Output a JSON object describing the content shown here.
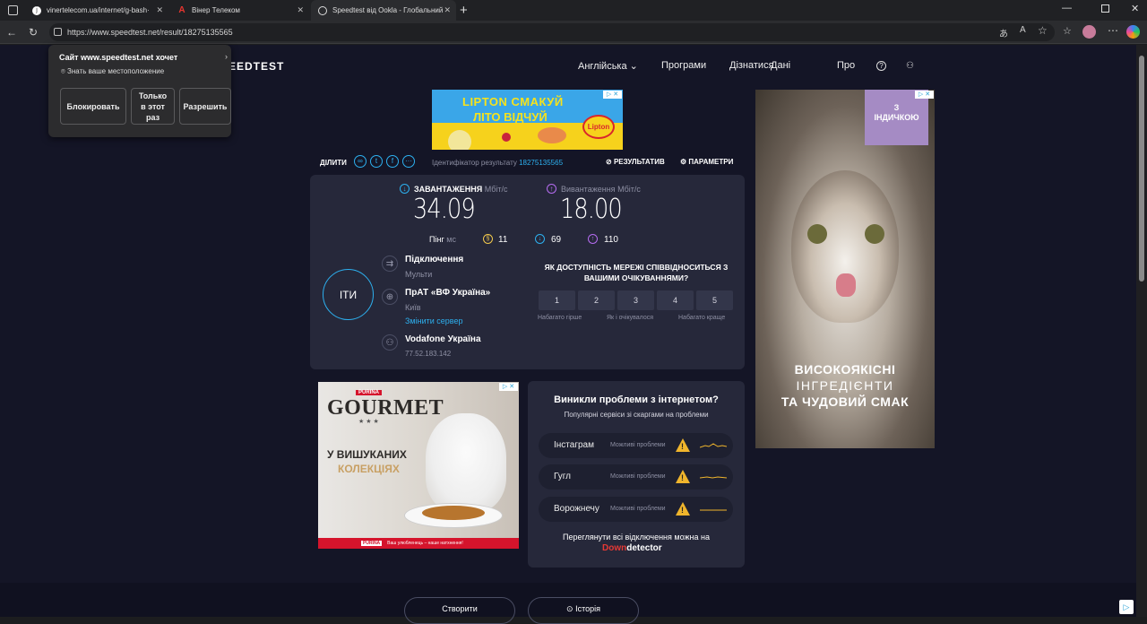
{
  "browser": {
    "tabs": [
      {
        "title": "vinertelecom.ua/internet/g-bash·",
        "favicon": "vt"
      },
      {
        "title": "Вінер Телеком",
        "favicon": "A"
      },
      {
        "title": "Speedtest від Ookla - Глобальний",
        "favicon": "ookla"
      }
    ],
    "url": "https://www.speedtest.net/result/18275135565"
  },
  "permission_popup": {
    "title": "Сайт www.speedtest.net хочет",
    "request": "Знать ваше местоположение",
    "block": "Блокировать",
    "once": "Только в этот раз",
    "allow": "Разрешить"
  },
  "site": {
    "logo": "EEDTEST",
    "nav": [
      "Англійська",
      "Програми",
      "Дізнатися",
      "Дані",
      "Про"
    ]
  },
  "ads": {
    "top_banner": {
      "line1": "LIPTON СМАКУЙ",
      "line2": "ЛІТО ВІДЧУЙ",
      "brand": "Lipton"
    },
    "right": {
      "tag1": "З",
      "tag2": "ІНДИЧКОЮ",
      "line1": "ВИСОКОЯКІСНІ",
      "line2": "ІНГРЕДІЄНТИ",
      "line3": "ТА ЧУДОВИЙ СМАК"
    },
    "bottom": {
      "brand_small": "PURINA",
      "brand": "GOURMET",
      "line1": "У ВИШУКАНИХ",
      "line2": "КОЛЕКЦІЯХ",
      "footer_brand": "PURINA",
      "footer_text": "Ваш улюбленець – наше натхнення!"
    }
  },
  "share": {
    "label": "ДІЛИТИ",
    "result_id_label": "Ідентифікатор результату",
    "result_id": "18275135565",
    "results": "РЕЗУЛЬТАТИВ",
    "settings": "ПАРАМЕТРИ"
  },
  "result": {
    "download_label": "ЗАВАНТАЖЕННЯ",
    "upload_label": "Вивантаження",
    "unit": "Мбіт/с",
    "download": "34.09",
    "upload": "18.00",
    "ping_label": "Пінг",
    "ping_unit": "мс",
    "ping_idle": "11",
    "ping_down": "69",
    "ping_up": "110",
    "go_button": "ІТИ",
    "connection_label": "Підключення",
    "connection_value": "Мульти",
    "server_name": "ПрАТ «ВФ Україна»",
    "server_city": "Київ",
    "change_server": "Змінити сервер",
    "provider": "Vodafone Україна",
    "ip": "77.52.183.142"
  },
  "rating": {
    "question": "ЯК ДОСТУПНІСТЬ МЕРЕЖІ СПІВВІДНОСИТЬСЯ З ВАШИМИ ОЧІКУВАННЯМИ?",
    "options": [
      "1",
      "2",
      "3",
      "4",
      "5"
    ],
    "worse": "Набагато гірше",
    "expected": "Як і очікувалося",
    "better": "Набагато краще"
  },
  "problems": {
    "title": "Виникли проблеми з інтернетом?",
    "subtitle": "Популярні сервіси зі скаргами на проблеми",
    "items": [
      {
        "name": "Інстаграм",
        "status": "Можливі проблеми"
      },
      {
        "name": "Гугл",
        "status": "Можливі проблеми"
      },
      {
        "name": "Ворожнечу",
        "status": "Можливі проблеми"
      }
    ],
    "footer": "Переглянути всі відключення можна на",
    "brand_red": "Down",
    "brand_white": "detector"
  },
  "bottom_buttons": {
    "create": "Створити",
    "history": "Історія"
  },
  "colors": {
    "accent": "#2db0ef",
    "upload": "#b56cf0",
    "ping": "#f2c94c",
    "warning": "#f0b52c",
    "page_bg": "#141526",
    "card_bg": "#26283a"
  }
}
